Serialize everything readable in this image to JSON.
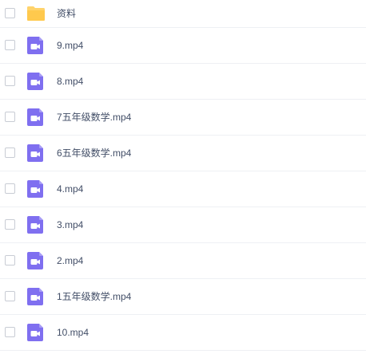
{
  "colors": {
    "folder": "#ffd36b",
    "video_icon_bg": "#7f6ff0",
    "checkbox_border": "#c8ccd4",
    "divider": "#eef0f4",
    "text": "#424e67"
  },
  "files": [
    {
      "name": "资料",
      "type": "folder",
      "icon": "folder-icon"
    },
    {
      "name": "9.mp4",
      "type": "video",
      "icon": "video-file-icon"
    },
    {
      "name": "8.mp4",
      "type": "video",
      "icon": "video-file-icon"
    },
    {
      "name": "7五年级数学.mp4",
      "type": "video",
      "icon": "video-file-icon"
    },
    {
      "name": "6五年级数学.mp4",
      "type": "video",
      "icon": "video-file-icon"
    },
    {
      "name": "4.mp4",
      "type": "video",
      "icon": "video-file-icon"
    },
    {
      "name": "3.mp4",
      "type": "video",
      "icon": "video-file-icon"
    },
    {
      "name": "2.mp4",
      "type": "video",
      "icon": "video-file-icon"
    },
    {
      "name": "1五年级数学.mp4",
      "type": "video",
      "icon": "video-file-icon"
    },
    {
      "name": "10.mp4",
      "type": "video",
      "icon": "video-file-icon"
    }
  ]
}
